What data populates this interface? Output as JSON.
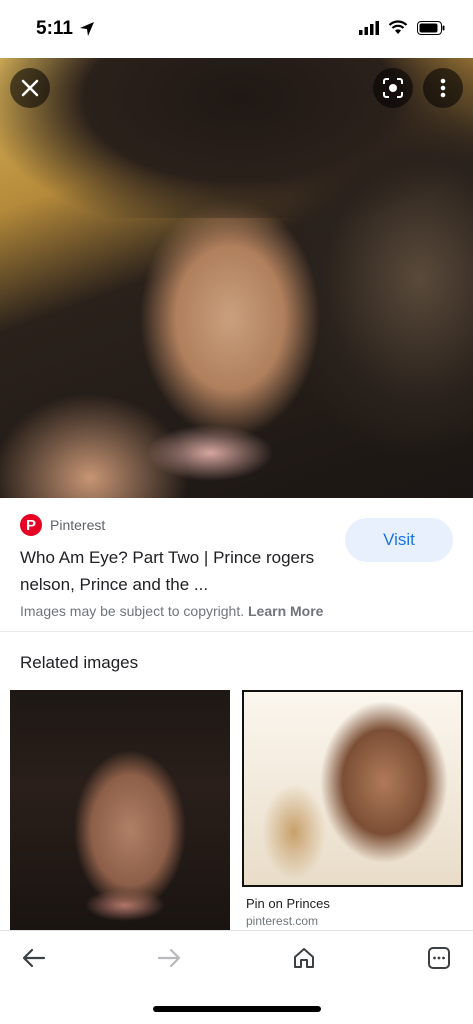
{
  "status_bar": {
    "time": "5:11"
  },
  "source": {
    "name": "Pinterest"
  },
  "result": {
    "title": "Who Am Eye? Part Two | Prince rogers nelson, Prince and the ...",
    "visit_label": "Visit"
  },
  "copyright": {
    "text": "Images may be subject to copyright.",
    "link": "Learn More"
  },
  "related": {
    "heading": "Related images",
    "items": [
      {
        "caption": "",
        "domain": ""
      },
      {
        "caption": "Pin on Princes",
        "domain": "pinterest.com"
      }
    ]
  },
  "colors": {
    "accent": "#1a73e8",
    "visit_bg": "#e8f0fe",
    "pinterest": "#e60023"
  },
  "icons": [
    "location-arrow-icon",
    "signal-icon",
    "wifi-icon",
    "battery-icon",
    "close-icon",
    "lens-icon",
    "more-vert-icon",
    "back-icon",
    "forward-icon",
    "home-icon",
    "tabs-icon"
  ]
}
